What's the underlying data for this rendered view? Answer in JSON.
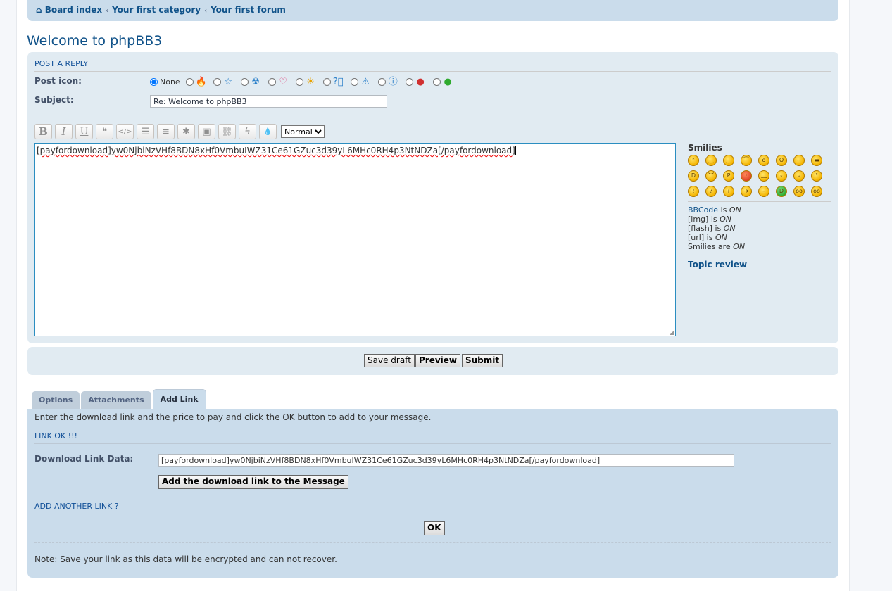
{
  "breadcrumbs": [
    "Board index",
    "Your first category",
    "Your first forum"
  ],
  "topic_title": "Welcome to phpBB3",
  "post_reply": {
    "title": "POST A REPLY",
    "post_icon_label": "Post icon:",
    "none_label": "None",
    "icons": [
      "fire-icon",
      "star-icon",
      "radioactive-icon",
      "heart-icon",
      "sun-icon",
      "question-icon",
      "warning-icon",
      "info-icon",
      "red-face-icon",
      "green-face-icon"
    ],
    "subject_label": "Subject:",
    "subject_value": "Re: Welcome to phpBB3",
    "toolbar": [
      "B",
      "I",
      "U",
      "❝",
      "</>",
      "☰",
      "≡",
      "✱",
      "▣",
      "⛓",
      "ϟ",
      "💧"
    ],
    "size_value": "Normal",
    "message": "[payfordownload]yw0NjbiNzVHf8BDN8xHf0VmbuIWZ31Ce61GZuc3d39yL6MHc0RH4p3NtNDZa[/payfordownload]"
  },
  "sidebar": {
    "smilies_title": "Smilies",
    "bbcode": "BBCode",
    "is": "is",
    "are": "are",
    "on": "ON",
    "img": "[img]",
    "flash": "[flash]",
    "url": "[url]",
    "smilies": "Smilies",
    "topic_review": "Topic review"
  },
  "buttons": {
    "save_draft": "Save draft",
    "preview": "Preview",
    "submit": "Submit"
  },
  "tabs": [
    "Options",
    "Attachments",
    "Add Link"
  ],
  "add_link": {
    "intro": "Enter the download link and the price to pay and click the OK button to add to your message.",
    "link_ok": "LINK OK !!!",
    "download_label": "Download Link Data:",
    "download_value": "[payfordownload]yw0NjbiNzVHf8BDN8xHf0VmbuIWZ31Ce61GZuc3d39yL6MHc0RH4p3NtNDZa[/payfordownload]",
    "add_button": "Add the download link to the Message",
    "add_another": "ADD ANOTHER LINK ?",
    "ok_button": "OK",
    "note": "Note: Save your link as this data will be encrypted and can not recover."
  }
}
